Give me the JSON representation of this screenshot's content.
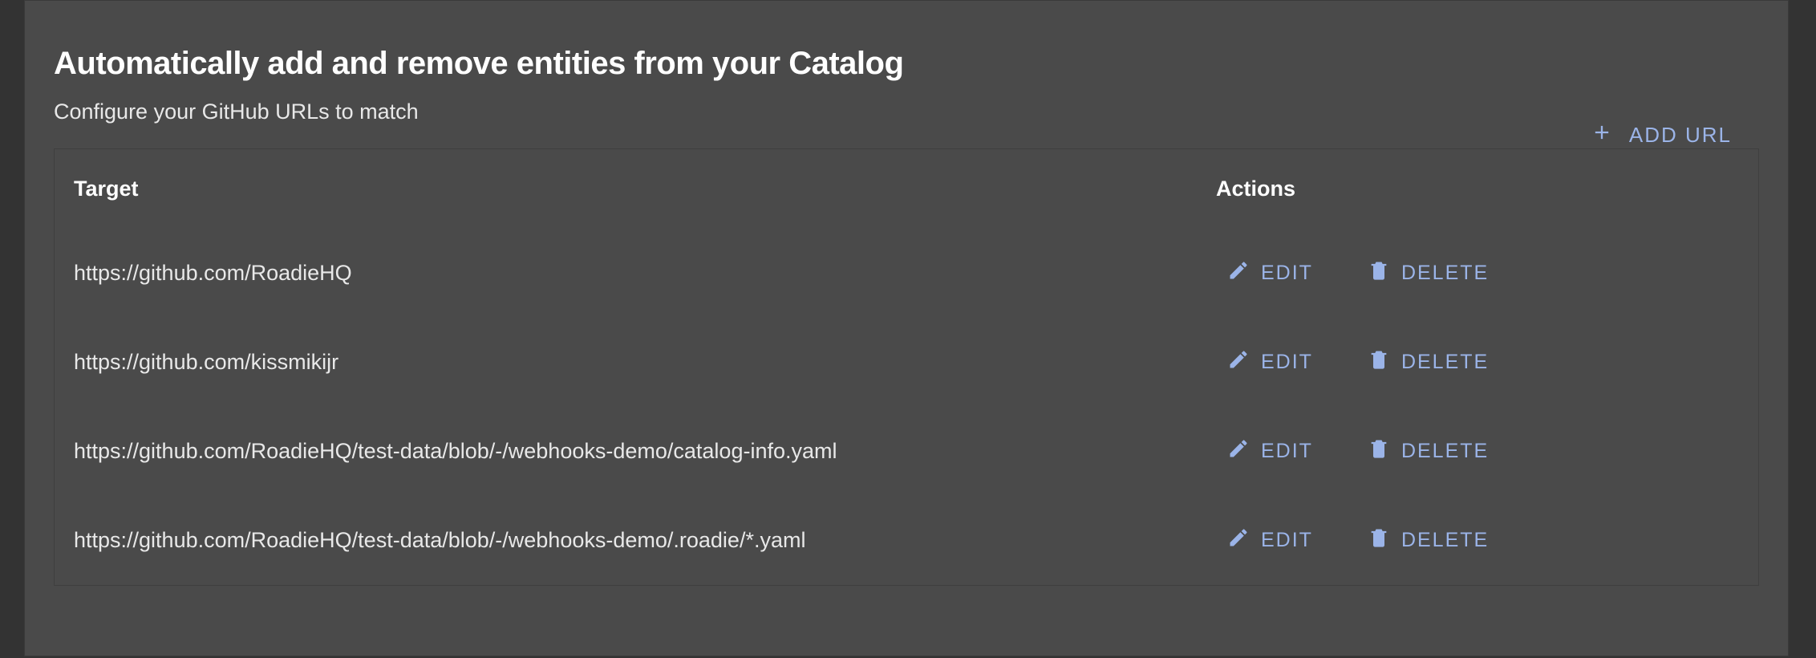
{
  "header": {
    "title": "Automatically add and remove entities from your Catalog",
    "subtitle": "Configure your GitHub URLs to match",
    "add_url_label": "ADD URL"
  },
  "table": {
    "columns": {
      "target": "Target",
      "actions": "Actions"
    },
    "action_labels": {
      "edit": "EDIT",
      "delete": "DELETE"
    },
    "rows": [
      {
        "target": "https://github.com/RoadieHQ"
      },
      {
        "target": "https://github.com/kissmikijr"
      },
      {
        "target": "https://github.com/RoadieHQ/test-data/blob/-/webhooks-demo/catalog-info.yaml"
      },
      {
        "target": "https://github.com/RoadieHQ/test-data/blob/-/webhooks-demo/.roadie/*.yaml"
      }
    ]
  },
  "colors": {
    "accent": "#9bb4e8",
    "panel": "#4a4a4a",
    "bg": "#333333"
  }
}
